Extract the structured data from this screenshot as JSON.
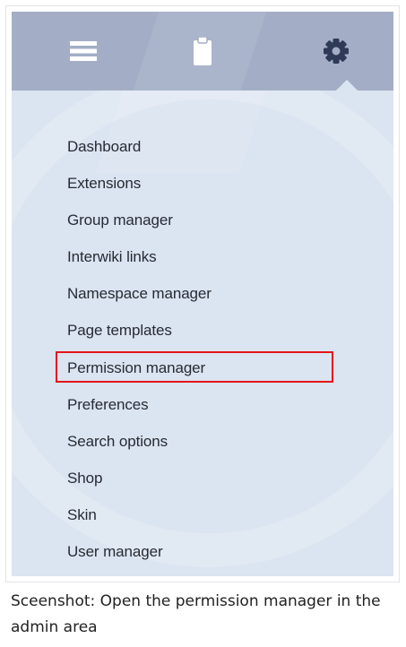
{
  "header": {
    "tabs": [
      {
        "icon": "hamburger-menu-icon"
      },
      {
        "icon": "clipboard-icon"
      },
      {
        "icon": "gear-icon",
        "active": true
      }
    ]
  },
  "admin_menu": {
    "items": [
      "Dashboard",
      "Extensions",
      "Group manager",
      "Interwiki links",
      "Namespace manager",
      "Page templates",
      "Permission manager",
      "Preferences",
      "Search options",
      "Shop",
      "Skin",
      "User manager"
    ],
    "highlighted_item": "Permission manager"
  },
  "caption": "Sceenshot: Open the permission manager in the admin area",
  "colors": {
    "header": "#a3aec6",
    "panel": "#dbe4f1",
    "highlight": "#e3161b",
    "icon": "#ffffff",
    "icon_active": "#2e3a57"
  }
}
